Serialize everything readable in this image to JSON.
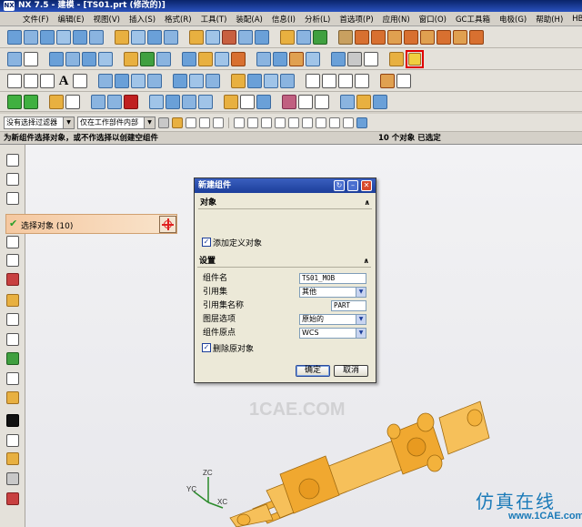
{
  "window": {
    "app_logo": "NX",
    "title": "NX 7.5 - 建模 - [TS01.prt (修改的)]"
  },
  "menubar": {
    "items": [
      "文件(F)",
      "编辑(E)",
      "视图(V)",
      "插入(S)",
      "格式(R)",
      "工具(T)",
      "装配(A)",
      "信息(I)",
      "分析(L)",
      "首选项(P)",
      "应用(N)",
      "窗口(O)",
      "GC工具箱",
      "电极(G)",
      "帮助(H)",
      "HB_MOU"
    ]
  },
  "toolbar": {
    "text_tool_label": "A"
  },
  "filterbar": {
    "type_filter": "没有选择过滤器",
    "scope_filter": "仅在工作部件内部"
  },
  "status": {
    "prompt": "为新组件选择对象，或不作选择以创建空组件",
    "selection_count": "10 个对象 已选定"
  },
  "dialog": {
    "title": "新建组件",
    "object_group": {
      "header": "对象",
      "select_object_label": "选择对象 (10)",
      "add_defined_objects_label": "添加定义对象",
      "add_defined_objects_checked": true
    },
    "settings_group": {
      "header": "设置",
      "component_name_label": "组件名",
      "component_name_value": "TS01_MOB",
      "reference_set_label": "引用集",
      "reference_set_value": "其他",
      "reference_set_name_label": "引用集名称",
      "reference_set_name_value": "PART",
      "layer_option_label": "图层选项",
      "layer_option_value": "原始的",
      "component_origin_label": "组件原点",
      "component_origin_value": "WCS",
      "delete_original_label": "删除原对象",
      "delete_original_checked": true
    },
    "ok_label": "确定",
    "cancel_label": "取消"
  },
  "viewport": {
    "watermark": "1CAE.COM",
    "axes": {
      "z": "ZC",
      "y": "YC",
      "x": "XC"
    },
    "model_color": "#f3b23c"
  },
  "brand": {
    "name": "仿真在线",
    "url": "www.1CAE.com"
  },
  "colors": {
    "highlight_red": "#e00000",
    "title_blue": "#0a246a",
    "selection_orange": "#f5c8a0"
  }
}
